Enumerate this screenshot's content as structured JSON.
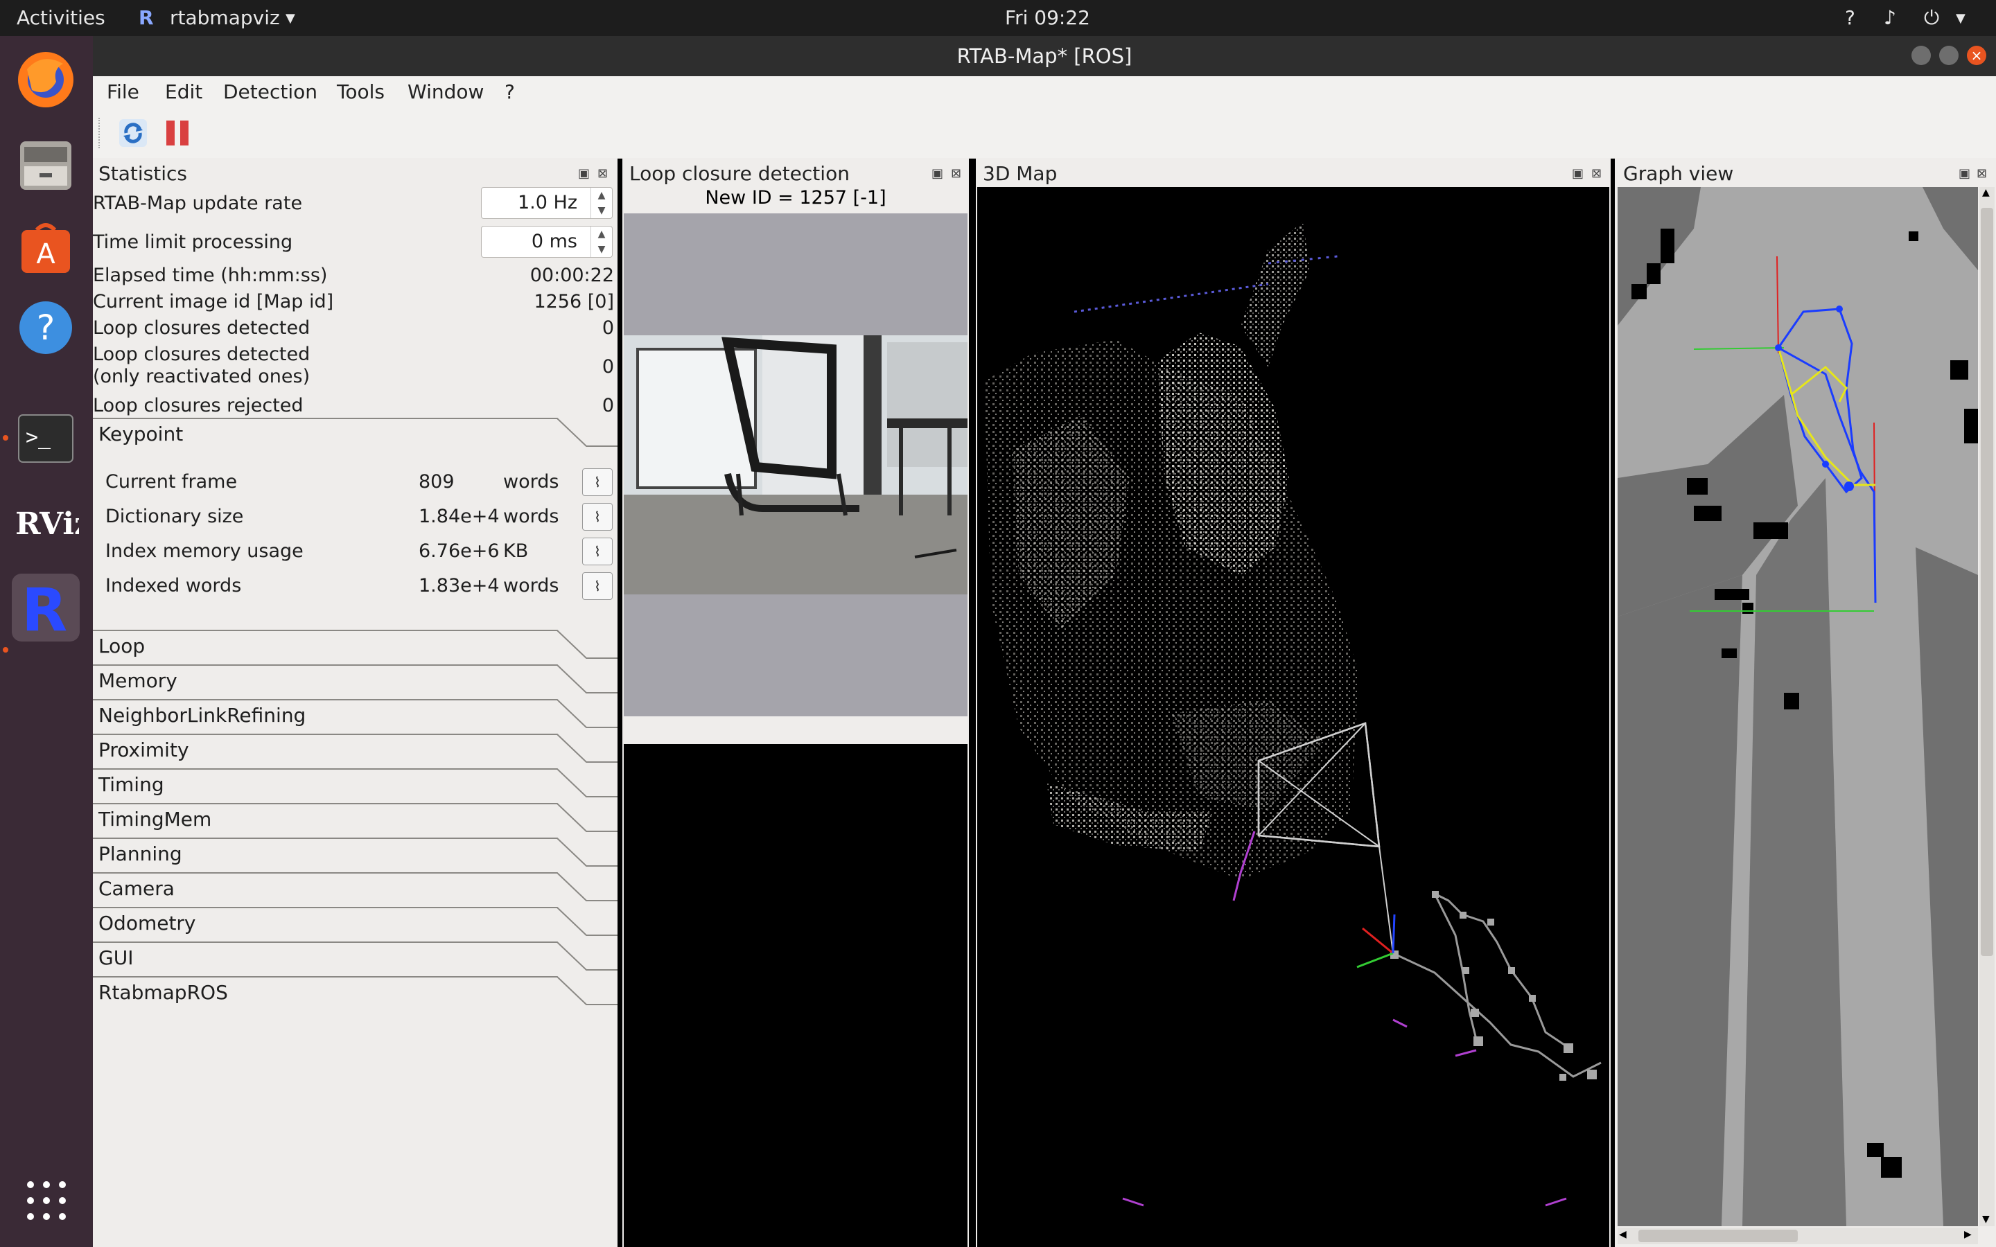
{
  "topbar": {
    "activities": "Activities",
    "app_name": "rtabmapviz",
    "clock": "Fri 09:22"
  },
  "window": {
    "title": "RTAB-Map* [ROS]"
  },
  "menu": [
    "File",
    "Edit",
    "Detection",
    "Tools",
    "Window",
    "?"
  ],
  "statistics": {
    "title": "Statistics",
    "update_rate_label": "RTAB-Map update rate",
    "update_rate_value": "1.0 Hz",
    "time_limit_label": "Time limit processing",
    "time_limit_value": "0 ms",
    "rows": [
      {
        "label": "Elapsed time (hh:mm:ss)",
        "value": "00:00:22"
      },
      {
        "label": "Current image id [Map id]",
        "value": "1256 [0]"
      },
      {
        "label": "Loop closures detected",
        "value": "0"
      },
      {
        "label": "Loop closures detected",
        "label2": "(only reactivated ones)",
        "value": "0"
      },
      {
        "label": "Loop closures rejected",
        "value": "0"
      }
    ],
    "keypoint": {
      "title": "Keypoint",
      "items": [
        {
          "label": "Current frame",
          "value": "809",
          "unit": "words"
        },
        {
          "label": "Dictionary size",
          "value": "1.84e+4",
          "unit": "words"
        },
        {
          "label": "Index memory usage",
          "value": "6.76e+6",
          "unit": "KB"
        },
        {
          "label": "Indexed words",
          "value": "1.83e+4",
          "unit": "words"
        }
      ]
    },
    "groups": [
      "Loop",
      "Memory",
      "NeighborLinkRefining",
      "Proximity",
      "Timing",
      "TimingMem",
      "Planning",
      "Camera",
      "Odometry",
      "GUI",
      "RtabmapROS"
    ]
  },
  "loop": {
    "title": "Loop closure detection",
    "new_id": "New ID = 1257 [-1]"
  },
  "map3d": {
    "title": "3D Map"
  },
  "graph": {
    "title": "Graph view"
  },
  "colors": {
    "accent": "#e95420",
    "dock_bg": "#3a2a36",
    "panel_bg": "#efedeb",
    "graph_blue": "#1a3cff",
    "graph_yellow": "#e6e61a",
    "graph_green": "#33cc33",
    "graph_red": "#e02020"
  }
}
